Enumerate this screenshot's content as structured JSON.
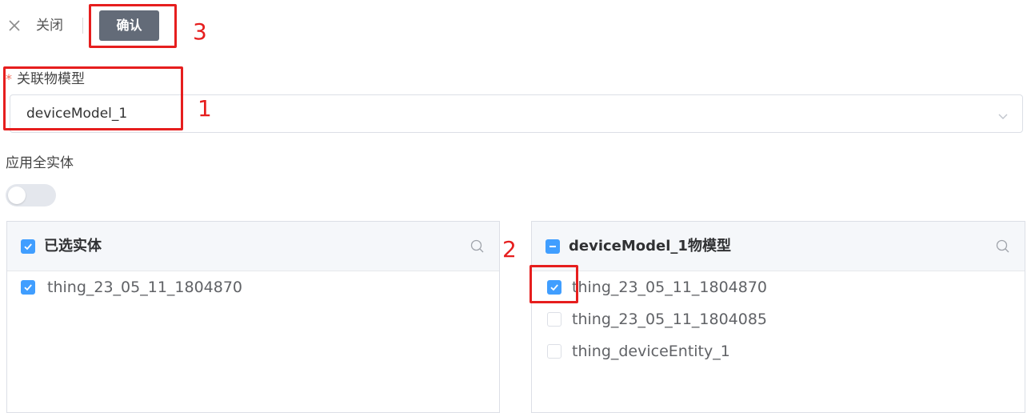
{
  "header": {
    "close_icon": "close-icon",
    "close_label": "关闭",
    "confirm_label": "确认"
  },
  "annotations": {
    "one": "1",
    "two": "2",
    "three": "3",
    "color": "#e61e1e"
  },
  "form": {
    "required_mark": "*",
    "model_label": "关联物模型",
    "model_value": "deviceModel_1",
    "apply_all_label": "应用全实体",
    "apply_all_enabled": false
  },
  "left_panel": {
    "title": "已选实体",
    "header_checkbox_state": "checked",
    "items": [
      {
        "label": "thing_23_05_11_1804870",
        "checked": true
      }
    ]
  },
  "right_panel": {
    "title": "deviceModel_1物模型",
    "header_checkbox_state": "indeterminate",
    "items": [
      {
        "label": "thing_23_05_11_1804870",
        "checked": true
      },
      {
        "label": "thing_23_05_11_1804085",
        "checked": false
      },
      {
        "label": "thing_deviceEntity_1",
        "checked": false
      }
    ]
  },
  "colors": {
    "primary": "#409eff",
    "confirm_button": "#636b78",
    "annotation": "#e61e1e"
  }
}
